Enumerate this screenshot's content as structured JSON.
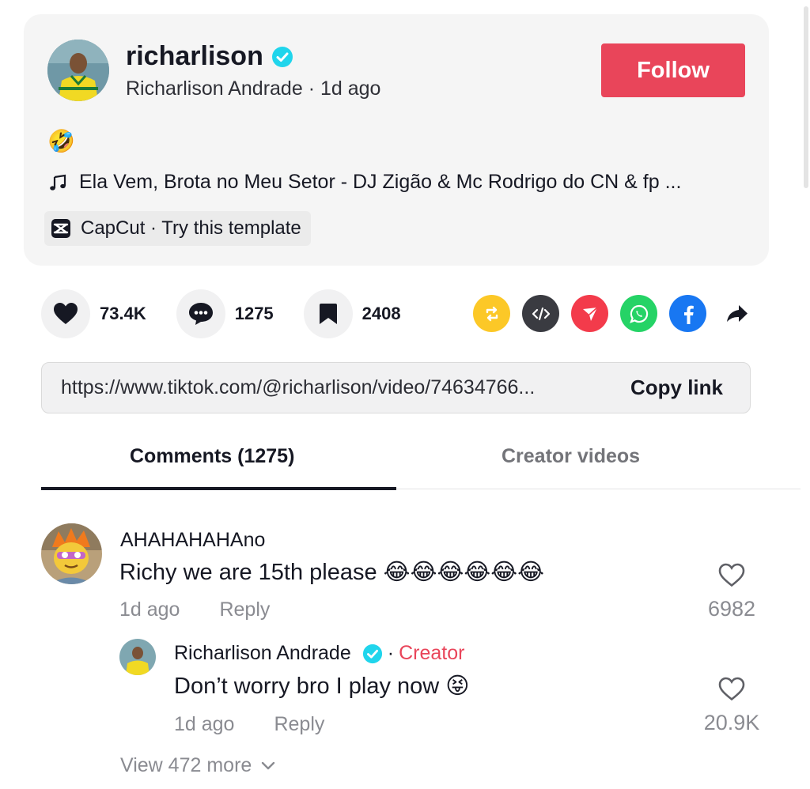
{
  "post": {
    "username": "richarlison",
    "display_name": "Richarlison Andrade",
    "age": "1d ago",
    "follow_label": "Follow",
    "caption_emoji": "🤣",
    "music": "Ela Vem, Brota no Meu Setor - DJ Zigão & Mc Rodrigo do CN & fp ...",
    "capcut": "CapCut · Try this template"
  },
  "stats": {
    "likes": "73.4K",
    "comments": "1275",
    "saves": "2408"
  },
  "share_icons": [
    "repost-icon",
    "embed-icon",
    "send-icon",
    "whatsapp-icon",
    "facebook-icon",
    "share-arrow-icon"
  ],
  "link": {
    "url": "https://www.tiktok.com/@richarlison/video/74634766...",
    "copy_label": "Copy link"
  },
  "tabs": {
    "comments": "Comments (1275)",
    "creator": "Creator videos"
  },
  "comments": [
    {
      "user": "AHAHAHAHAno",
      "text": "Richy we are 15th please 😂😂😂😂😂😂",
      "time": "1d ago",
      "reply": "Reply",
      "likes": "6982"
    }
  ],
  "reply": {
    "user": "Richarlison Andrade",
    "badge_sep": "·",
    "badge": "Creator",
    "text": "Don’t worry bro I play now 😝",
    "time": "1d ago",
    "reply": "Reply",
    "likes": "20.9K"
  },
  "view_more": "View 472 more",
  "colors": {
    "accent": "#e9455a",
    "verified": "#20d5ec",
    "repost": "#fcc827",
    "send": "#f33b4b",
    "whatsapp": "#25d366",
    "facebook": "#1877f2"
  }
}
